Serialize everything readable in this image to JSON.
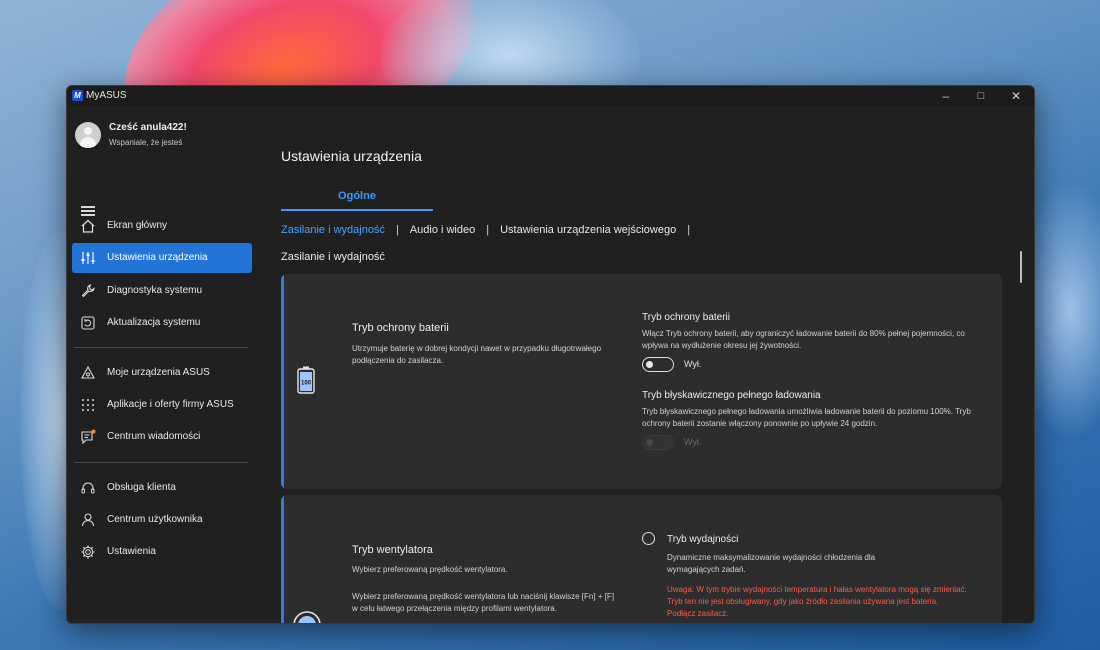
{
  "window": {
    "title": "MyASUS",
    "logo_text": "M"
  },
  "user": {
    "greeting": "Cześć anula422!",
    "subtitle": "Wspaniale, że jesteś"
  },
  "sidebar": {
    "items": [
      {
        "label": "Ekran główny",
        "icon": "home-icon"
      },
      {
        "label": "Ustawienia urządzenia",
        "icon": "sliders-icon",
        "active": true
      },
      {
        "label": "Diagnostyka systemu",
        "icon": "wrench-icon"
      },
      {
        "label": "Aktualizacja systemu",
        "icon": "update-icon"
      },
      {
        "label": "Moje urządzenia ASUS",
        "icon": "devices-icon"
      },
      {
        "label": "Aplikacje i oferty firmy ASUS",
        "icon": "apps-grid-icon"
      },
      {
        "label": "Centrum wiadomości",
        "icon": "message-icon",
        "notification_dot_color": "#f28a3a"
      },
      {
        "label": "Obsługa klienta",
        "icon": "headset-icon"
      },
      {
        "label": "Centrum użytkownika",
        "icon": "user-icon"
      },
      {
        "label": "Ustawienia",
        "icon": "gear-icon"
      }
    ]
  },
  "main": {
    "title": "Ustawienia urządzenia",
    "tab": "Ogólne",
    "subtabs": [
      "Zasilanie i wydajność",
      "Audio i wideo",
      "Ustawienia urządzenia wejściowego"
    ],
    "section_title": "Zasilanie i wydajność"
  },
  "battery_card": {
    "title": "Tryb ochrony baterii",
    "description": "Utrzymuje baterię w dobrej kondycji nawet w przypadku długotrwałego podłączenia do zasilacza.",
    "icon_text": "100",
    "option1": {
      "title": "Tryb ochrony baterii",
      "description": "Włącz Tryb ochrony baterii, aby ograniczyć ładowanie baterii do 80% pełnej pojemności, co wpływa na wydłużenie okresu jej żywotności.",
      "toggle_label": "Wył."
    },
    "option2": {
      "title": "Tryb błyskawicznego pełnego ładowania",
      "description": "Tryb błyskawicznego pełnego ładowania umożliwia ładowanie baterii do poziomu 100%. Tryb ochrony baterii zostanie włączony ponownie po upływie 24 godzin.",
      "toggle_label": "Wył."
    }
  },
  "fan_card": {
    "title": "Tryb wentylatora",
    "description1": "Wybierz preferowaną prędkość wentylatora.",
    "description2": "Wybierz preferowaną prędkość wentylatora lub naciśnij klawisze [Fn] + [F] w celu łatwego przełączenia między profilami wentylatora.",
    "option": {
      "label": "Tryb wydajności",
      "description": "Dynamiczne maksymalizowanie wydajności chłodzenia dla wymagających zadań.",
      "warning": "Uwaga: W tym trybie wydajności temperatura i hałas wentylatora mogą się zmieniać. Tryb ten nie jest obsługiwany, gdy jako źródło zasilania używana jest bateria. Podłącz zasilacz."
    }
  },
  "colors": {
    "accent": "#2275d6",
    "link": "#4aa3ff",
    "warning": "#ff5a4a"
  }
}
